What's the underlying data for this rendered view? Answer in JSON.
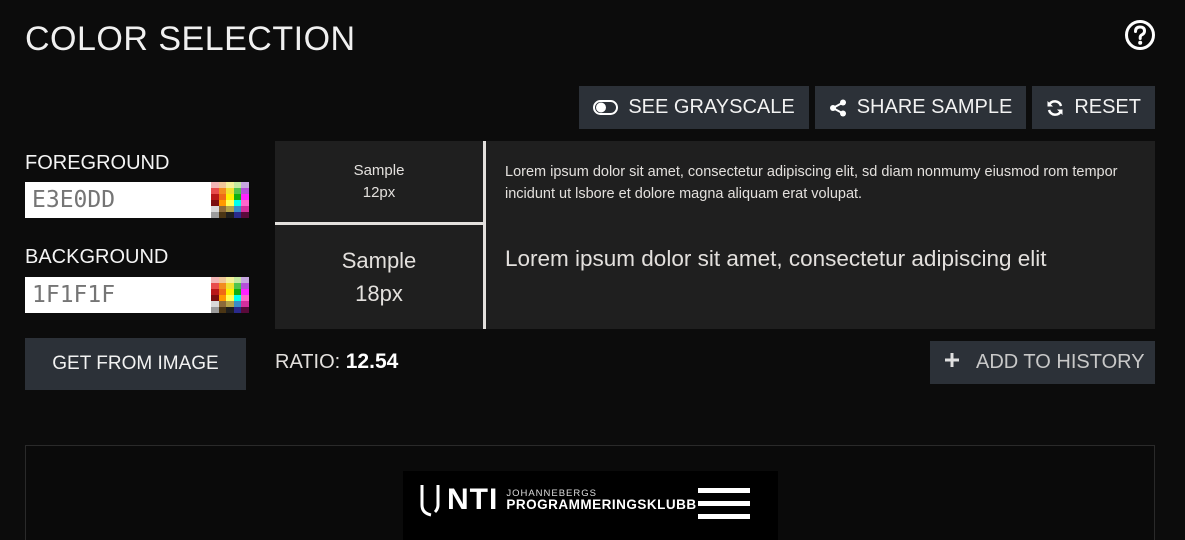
{
  "header": {
    "title": "COLOR SELECTION",
    "help_icon": "question-circle-icon"
  },
  "toolbar": {
    "grayscale_label": "SEE GRAYSCALE",
    "share_label": "SHARE SAMPLE",
    "reset_label": "RESET"
  },
  "foreground": {
    "label": "FOREGROUND",
    "placeholder": "E3E0DD",
    "value": "",
    "color": "#e3e0dd"
  },
  "background": {
    "label": "BACKGROUND",
    "placeholder": "1F1F1F",
    "value": "",
    "color": "#1f1f1f"
  },
  "samples": {
    "small": {
      "label_line1": "Sample",
      "label_line2": "12px",
      "text": "Lorem ipsum dolor sit amet, consectetur adipiscing elit, sd diam nonmumy eiusmod rom tempor incidunt ut lsbore et dolore magna aliquam erat volupat."
    },
    "large": {
      "label_line1": "Sample",
      "label_line2": "18px",
      "text": "Lorem ipsum dolor sit amet, consectetur adipiscing elit"
    }
  },
  "get_from_image_label": "GET FROM IMAGE",
  "ratio": {
    "label": "RATIO:",
    "value": "12.54"
  },
  "add_to_history_label": "ADD TO HISTORY",
  "preview_image": {
    "logo_text": "NTI",
    "org_small": "JOHANNEBERGS",
    "org_big": "PROGRAMMERINGSKLUBB"
  },
  "swatch_colors": [
    "#f3b6b6",
    "#f0c79a",
    "#f4f09a",
    "#c3e9a0",
    "#c7a7e0",
    "#e84c4c",
    "#f28c1e",
    "#f0e030",
    "#4ec34e",
    "#b54fd9",
    "#b81818",
    "#ef6a16",
    "#fff000",
    "#11b011",
    "#ff22ff",
    "#7a0f0f",
    "#ff9900",
    "#ffff55",
    "#00ffee",
    "#ff66cc",
    "#d9d9d9",
    "#8c6a3a",
    "#b3a24a",
    "#3a8cc9",
    "#d62f9e",
    "#9c9c9c",
    "#4a3514",
    "#1f1f1f",
    "#2a2a8c",
    "#5a0a3a"
  ]
}
